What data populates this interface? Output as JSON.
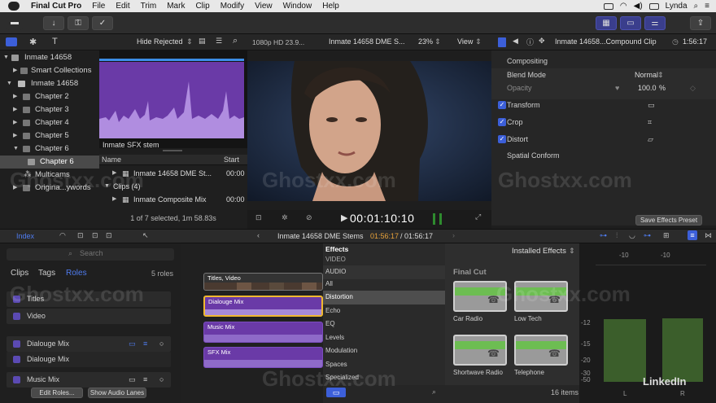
{
  "menubar": {
    "app": "Final Cut Pro",
    "items": [
      "File",
      "Edit",
      "Trim",
      "Mark",
      "Clip",
      "Modify",
      "View",
      "Window",
      "Help"
    ],
    "user": "Lynda"
  },
  "browser": {
    "filter": "Hide Rejected",
    "libraries": [
      {
        "label": "Inmate 14658",
        "level": 0
      },
      {
        "label": "Smart Collections",
        "level": 1
      },
      {
        "label": "Inmate 14658",
        "level": 0
      },
      {
        "label": "Chapter 2",
        "level": 1
      },
      {
        "label": "Chapter 3",
        "level": 1
      },
      {
        "label": "Chapter 4",
        "level": 1
      },
      {
        "label": "Chapter 5",
        "level": 1
      },
      {
        "label": "Chapter 6",
        "level": 1
      },
      {
        "label": "Chapter 6",
        "level": 2
      },
      {
        "label": "Multicams",
        "level": 1
      },
      {
        "label": "Origina...ywords",
        "level": 1
      }
    ],
    "clip_label": "Inmate SFX stem",
    "list_headers": {
      "name": "Name",
      "start": "Start"
    },
    "rows": [
      {
        "name": "Inmate 14658 DME St...",
        "start": "00:00"
      },
      {
        "name": "Clips  (4)",
        "start": ""
      },
      {
        "name": "Inmate Composite Mix",
        "start": "00:00"
      }
    ],
    "selection_status": "1 of 7 selected, 1m 58.83s"
  },
  "viewer": {
    "format": "1080p HD 23.9...",
    "clip_name": "Inmate 14658 DME S...",
    "zoom": "23%",
    "view_label": "View",
    "timecode": "00:01:10:10"
  },
  "inspector": {
    "clip_title": "Inmate 14658...Compound Clip",
    "duration": "1:56:17",
    "compositing": "Compositing",
    "blend_label": "Blend Mode",
    "blend_value": "Normal",
    "opacity_label": "Opacity",
    "opacity_value": "100.0",
    "opacity_unit": "%",
    "sections": [
      "Transform",
      "Crop",
      "Distort"
    ],
    "spatial": "Spatial Conform",
    "save_preset": "Save Effects Preset"
  },
  "timeline_header": {
    "index": "Index",
    "project": "Inmate 14658 DME Stems",
    "position": "01:56:17",
    "total": "/ 01:56:17"
  },
  "index_panel": {
    "search_placeholder": "Search",
    "tabs": [
      "Clips",
      "Tags",
      "Roles"
    ],
    "roles_count": "5 roles",
    "roles": [
      "Titles",
      "Video",
      "Dialouge Mix",
      "Dialouge Mix",
      "Music Mix"
    ],
    "edit_roles": "Edit Roles...",
    "show_lanes": "Show Audio Lanes"
  },
  "timeline_clips": [
    "Titles, Video",
    "Dialouge Mix",
    "Music Mix",
    "SFX Mix"
  ],
  "effects_browser": {
    "header": "Effects",
    "installed": "Installed Effects",
    "categories": [
      "VIDEO",
      "AUDIO",
      "All",
      "Distortion",
      "Echo",
      "EQ",
      "Levels",
      "Modulation",
      "Spaces",
      "Specialized"
    ],
    "group": "Final Cut",
    "effects": [
      "Car Radio",
      "Low Tech",
      "Shortwave Radio",
      "Telephone"
    ],
    "count": "16 items"
  },
  "meters": {
    "scale": [
      "-10",
      "-10",
      "-12",
      "-15",
      "-20",
      "-30",
      "-50"
    ],
    "channels": [
      "L",
      "R"
    ]
  },
  "watermark": [
    "Ghostxx.com",
    "Ghostxx.com",
    "Ghostxx.com",
    "Ghostxx.com",
    "Ghostxx.com",
    "Ghostxx.com"
  ],
  "brand": "LinkedIn"
}
